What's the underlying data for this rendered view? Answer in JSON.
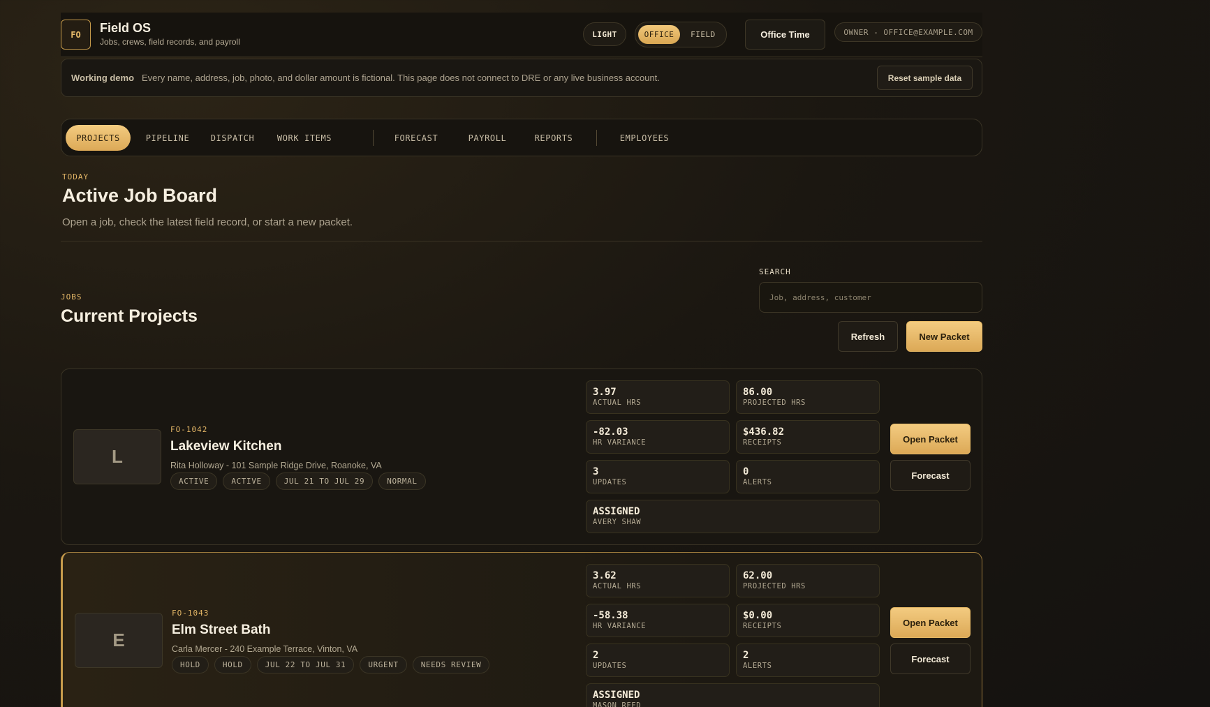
{
  "header": {
    "logo": "FO",
    "title": "Field OS",
    "subtitle": "Jobs, crews, field records, and payroll",
    "theme_label": "LIGHT",
    "mode_office": "OFFICE",
    "mode_field": "FIELD",
    "office_time": "Office Time",
    "owner": "OWNER - OFFICE@EXAMPLE.COM"
  },
  "banner": {
    "label": "Working demo",
    "text": "Every name, address, job, photo, and dollar amount is fictional. This page does not connect to DRE or any live business account.",
    "reset": "Reset sample data"
  },
  "nav": {
    "tabs": [
      "PROJECTS",
      "PIPELINE",
      "DISPATCH",
      "WORK ITEMS",
      "FORECAST",
      "PAYROLL",
      "REPORTS",
      "EMPLOYEES"
    ],
    "active": "PROJECTS"
  },
  "page": {
    "eyebrow": "TODAY",
    "title": "Active Job Board",
    "lead": "Open a job, check the latest field record, or start a new packet."
  },
  "jobs": {
    "eyebrow": "JOBS",
    "title": "Current Projects",
    "search_label": "SEARCH",
    "search_placeholder": "Job, address, customer",
    "search_value": "",
    "refresh": "Refresh",
    "new_packet": "New Packet"
  },
  "projects": [
    {
      "initial": "L",
      "id": "FO-1042",
      "name": "Lakeview Kitchen",
      "address": "Rita Holloway - 101 Sample Ridge Drive, Roanoke, VA",
      "tags": [
        "ACTIVE",
        "ACTIVE",
        "JUL 21 TO JUL 29",
        "NORMAL"
      ],
      "stats": {
        "actual_hrs": "3.97",
        "projected_hrs": "86.00",
        "hr_variance": "-82.03",
        "receipts": "$436.82",
        "updates": "3",
        "alerts": "0",
        "assigned": "AVERY SHAW"
      },
      "open": "Open Packet",
      "forecast": "Forecast"
    },
    {
      "initial": "E",
      "id": "FO-1043",
      "name": "Elm Street Bath",
      "address": "Carla Mercer - 240 Example Terrace, Vinton, VA",
      "tags": [
        "HOLD",
        "HOLD",
        "JUL 22 TO JUL 31",
        "URGENT",
        "NEEDS REVIEW"
      ],
      "stats": {
        "actual_hrs": "3.62",
        "projected_hrs": "62.00",
        "hr_variance": "-58.38",
        "receipts": "$0.00",
        "updates": "2",
        "alerts": "2",
        "assigned": "MASON REED"
      },
      "open": "Open Packet",
      "forecast": "Forecast"
    }
  ],
  "labels": {
    "actual_hrs": "ACTUAL HRS",
    "projected_hrs": "PROJECTED HRS",
    "hr_variance": "HR VARIANCE",
    "receipts": "RECEIPTS",
    "updates": "UPDATES",
    "alerts": "ALERTS",
    "assigned": "ASSIGNED"
  },
  "colors": {
    "accent": "#e2b566",
    "background": "#1b1711",
    "text": "#f6efe0"
  }
}
